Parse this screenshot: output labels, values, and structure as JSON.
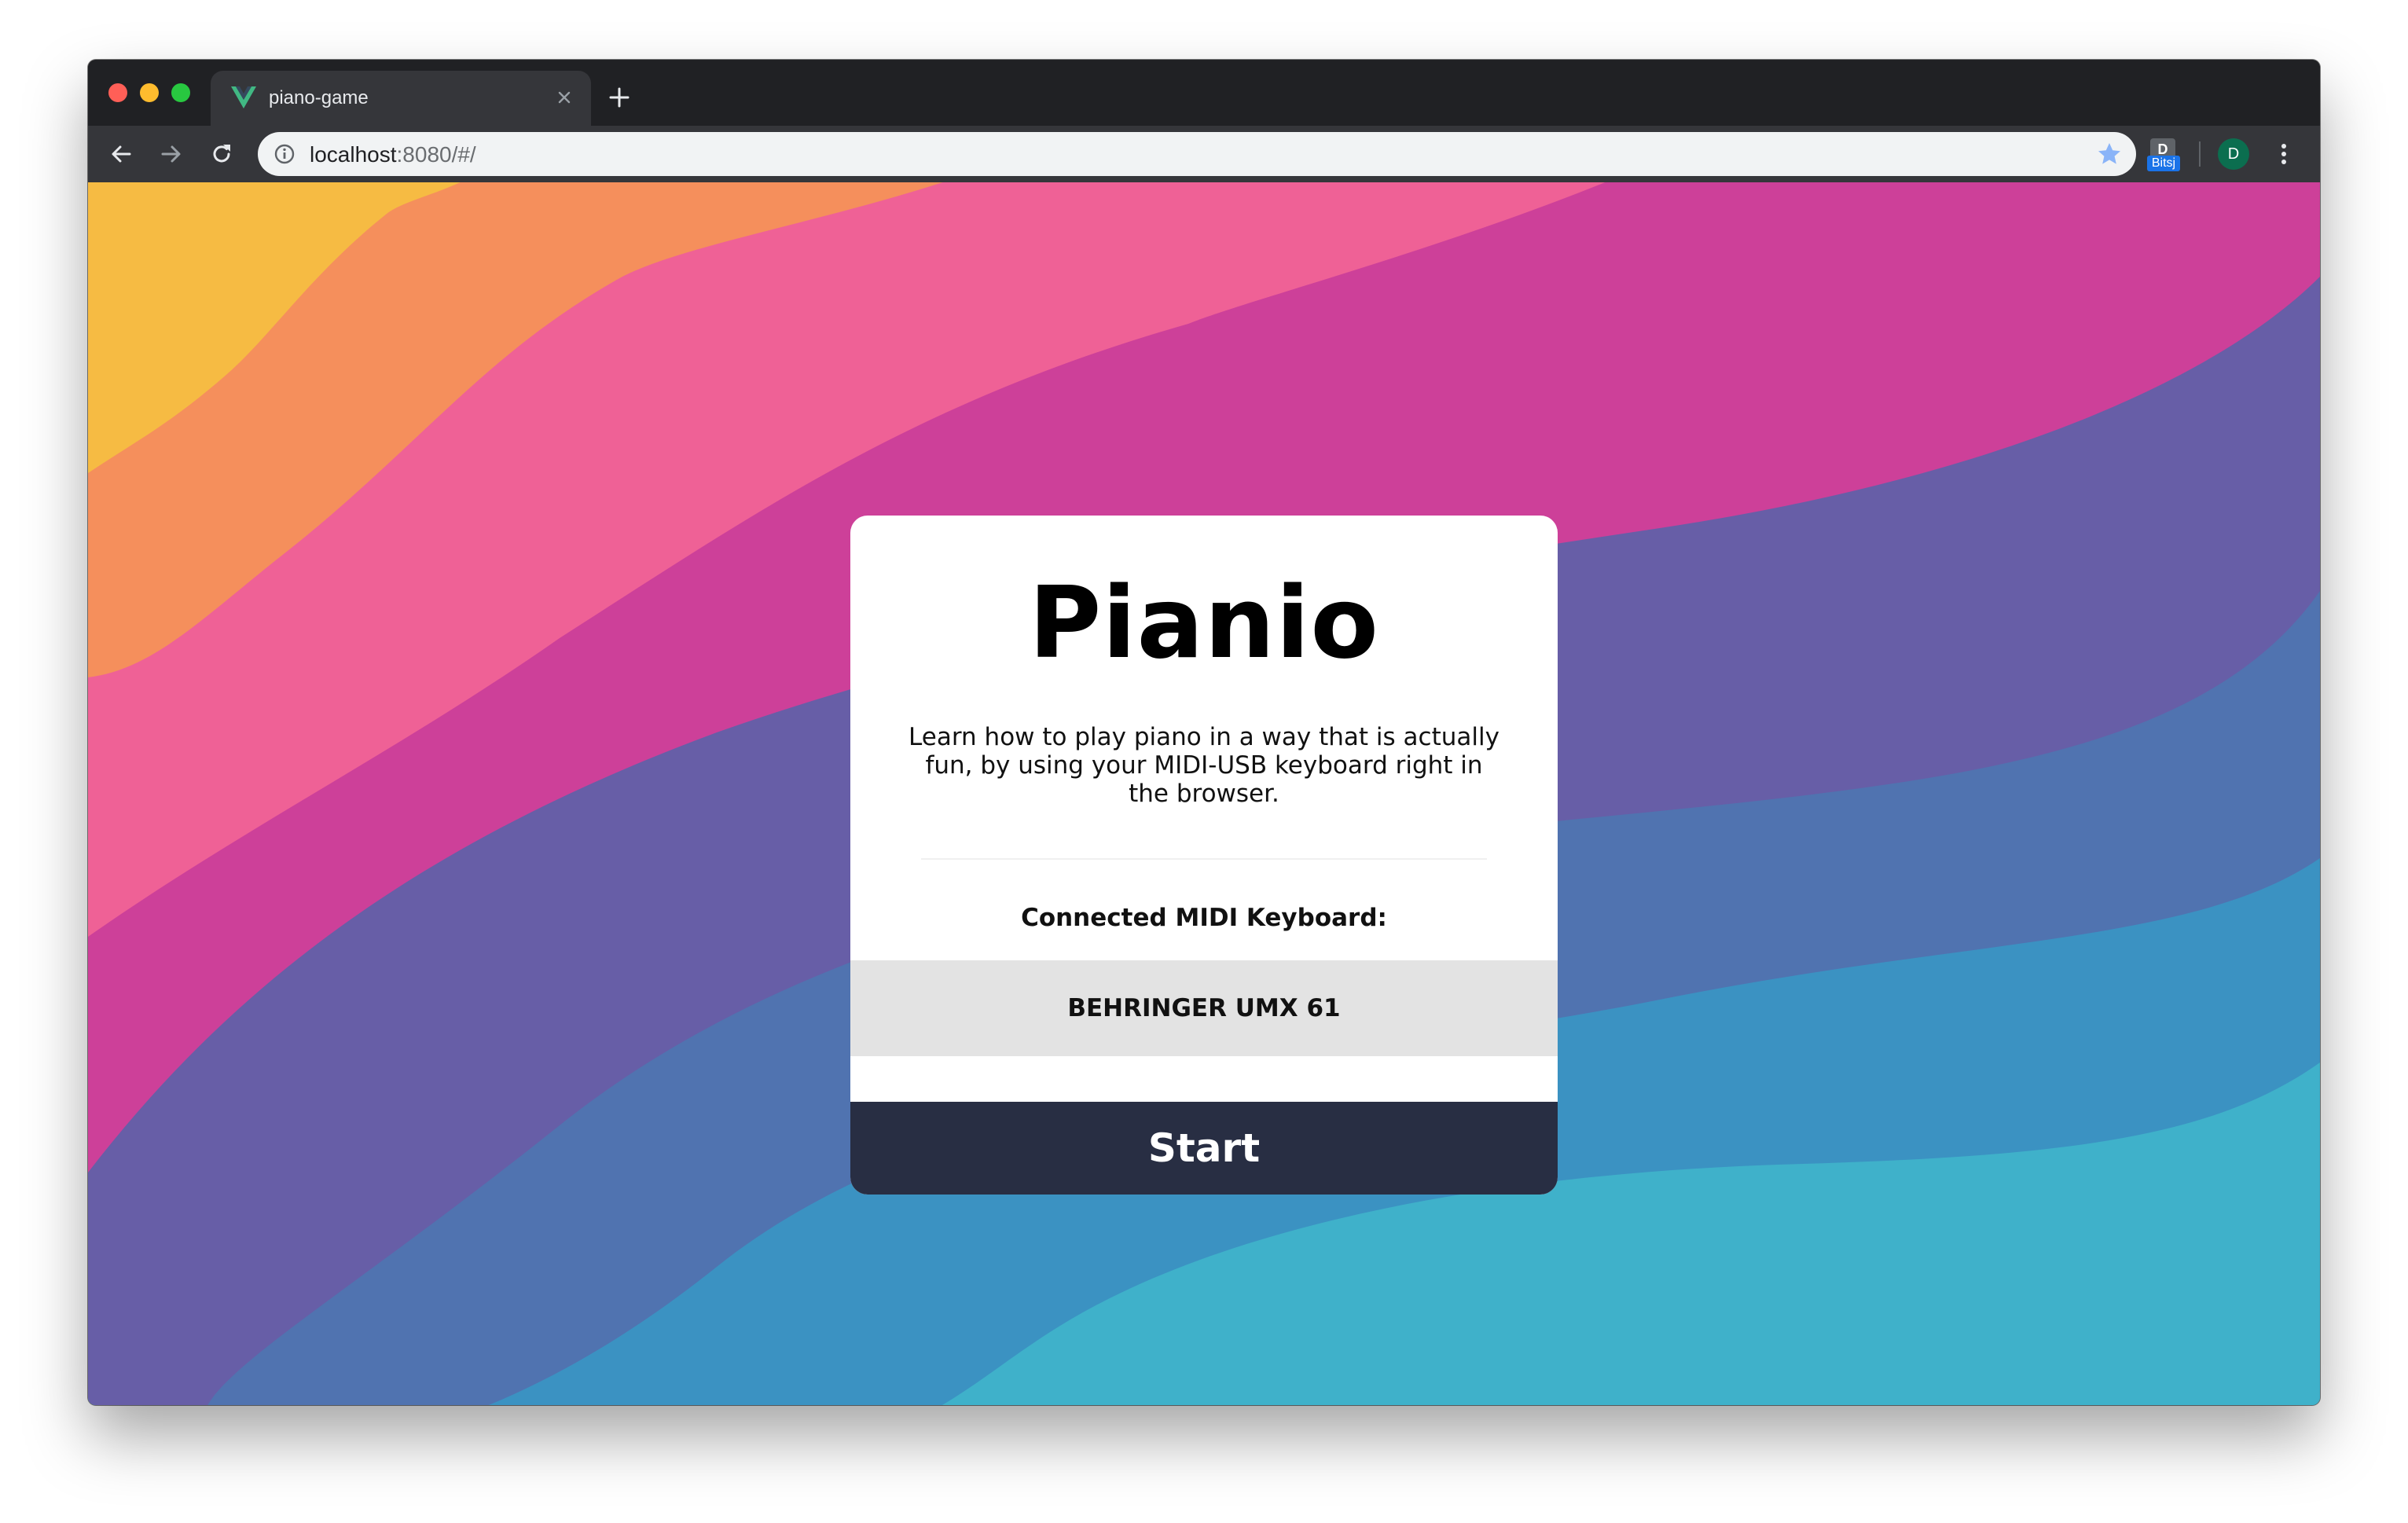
{
  "browser": {
    "tab": {
      "title": "piano-game",
      "favicon_icon": "vue-logo-icon"
    },
    "address_bar": {
      "url_host": "localhost",
      "url_rest": ":8080/#/"
    },
    "extension": {
      "icon": "bitsj-extension-icon",
      "badge": "Bitsj"
    },
    "profile": {
      "initial": "D",
      "color": "#0b6e4f"
    }
  },
  "app": {
    "title": "Pianio",
    "description": "Learn how to play piano in a way that is actually fun, by using your MIDI-USB keyboard right in the browser.",
    "midi_label": "Connected MIDI Keyboard:",
    "midi_device": "BEHRINGER UMX 61",
    "start_label": "Start"
  },
  "colors": {
    "wave_yellow": "#f6bb43",
    "wave_orange": "#f58f5c",
    "wave_pink": "#ef6196",
    "wave_magenta": "#cd4099",
    "wave_purple": "#675ea7",
    "wave_indigo": "#5073b0",
    "wave_blue": "#3b92c2",
    "wave_cyan": "#3fb1ca",
    "start_button": "#282e43",
    "device_row": "#e3e3e3"
  }
}
